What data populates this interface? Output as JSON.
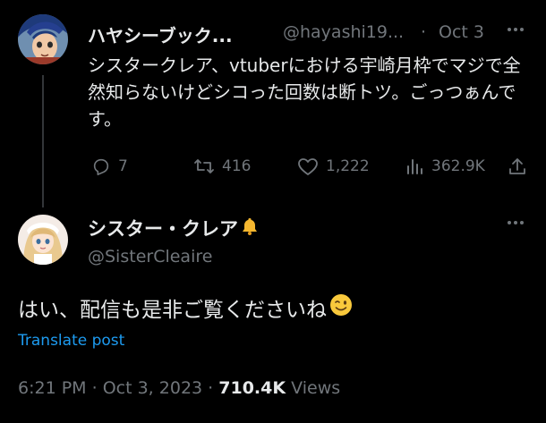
{
  "tweet1": {
    "display_name": "ハヤシーブック...",
    "handle": "@hayashi19...",
    "separator": "·",
    "date": "Oct 3",
    "text": "シスタークレア、vtuberにおける宇崎月枠でマジで全然知らないけどシコった回数は断トツ。ごっつぁんです。",
    "metrics": {
      "replies": "7",
      "retweets": "416",
      "likes": "1,222",
      "views": "362.9K"
    }
  },
  "tweet2": {
    "display_name": "シスター・クレア",
    "handle": "@SisterCleaire",
    "text": "はい、配信も是非ご覧くださいね",
    "translate_label": "Translate post",
    "time": "6:21 PM",
    "separator": "·",
    "date": "Oct 3, 2023",
    "separator2": "·",
    "view_count": "710.4K",
    "views_label": "Views"
  },
  "icons": [
    "more-icon",
    "reply-icon",
    "retweet-icon",
    "like-icon",
    "views-icon",
    "share-icon",
    "bell-emoji-icon",
    "wink-emoji-icon"
  ],
  "colors": {
    "background": "#000000",
    "text": "#e7e9ea",
    "muted": "#71767b",
    "link": "#1d9bf0",
    "divider": "#333639"
  }
}
